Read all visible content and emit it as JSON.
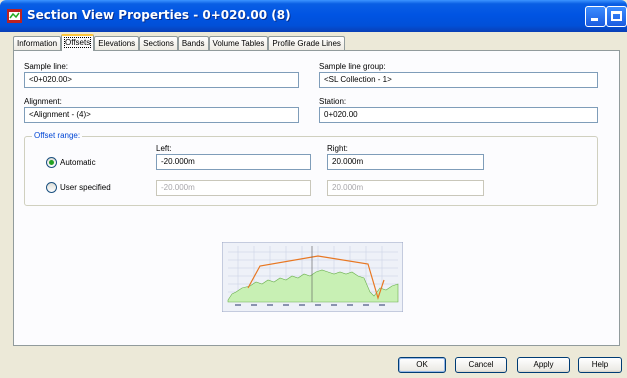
{
  "window": {
    "title": "Section View Properties - 0+020.00 (8)"
  },
  "tabs": [
    {
      "label": "Information",
      "active": false
    },
    {
      "label": "Offsets",
      "active": true
    },
    {
      "label": "Elevations",
      "active": false
    },
    {
      "label": "Sections",
      "active": false
    },
    {
      "label": "Bands",
      "active": false
    },
    {
      "label": "Volume Tables",
      "active": false
    },
    {
      "label": "Profile Grade Lines",
      "active": false
    }
  ],
  "form": {
    "sample_line_label": "Sample line:",
    "sample_line_value": "<0+020.00>",
    "sample_line_group_label": "Sample line group:",
    "sample_line_group_value": "<SL Collection - 1>",
    "alignment_label": "Alignment:",
    "alignment_value": "<Alignment - (4)>",
    "station_label": "Station:",
    "station_value": "0+020.00"
  },
  "offset_range": {
    "title": "Offset range:",
    "left_label": "Left:",
    "right_label": "Right:",
    "automatic_label": "Automatic",
    "automatic_selected": true,
    "automatic_left": "-20.000m",
    "automatic_right": "20.000m",
    "user_specified_label": "User specified",
    "user_specified_selected": false,
    "user_left": "-20.000m",
    "user_right": "20.000m"
  },
  "buttons": {
    "ok": "OK",
    "cancel": "Cancel",
    "apply": "Apply",
    "help": "Help"
  },
  "colors": {
    "titlebar": "#0054e3",
    "group_title": "#0046d5",
    "ground_fill": "#c8f0b4",
    "grade_line": "#e87722"
  }
}
